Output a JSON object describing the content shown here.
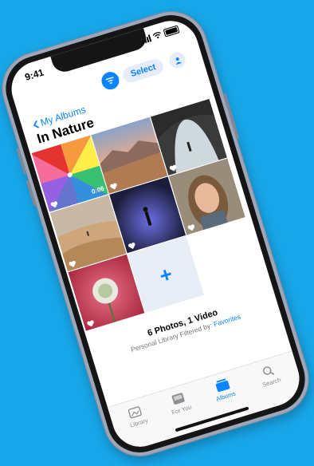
{
  "status": {
    "time": "9:41"
  },
  "toolbar": {
    "select_label": "Select"
  },
  "nav": {
    "back_label": "My Albums"
  },
  "album": {
    "title": "In Nature"
  },
  "photos": [
    {
      "name": "umbrella",
      "badge": "0:06",
      "favorite": true
    },
    {
      "name": "desert-mountains",
      "favorite": true
    },
    {
      "name": "rock-arch",
      "favorite": true
    },
    {
      "name": "dunes",
      "favorite": true
    },
    {
      "name": "person-dusk",
      "favorite": true
    },
    {
      "name": "portrait",
      "favorite": true
    },
    {
      "name": "flower",
      "favorite": true
    }
  ],
  "summary": {
    "title": "6 Photos, 1 Video",
    "subtitle_prefix": "Personal Library Filtered by:",
    "filter": "Favorites"
  },
  "tabs": [
    {
      "label": "Library"
    },
    {
      "label": "For You"
    },
    {
      "label": "Albums"
    },
    {
      "label": "Search"
    }
  ],
  "colors": {
    "accent": "#0a84ff",
    "background": "#17a7e9"
  }
}
